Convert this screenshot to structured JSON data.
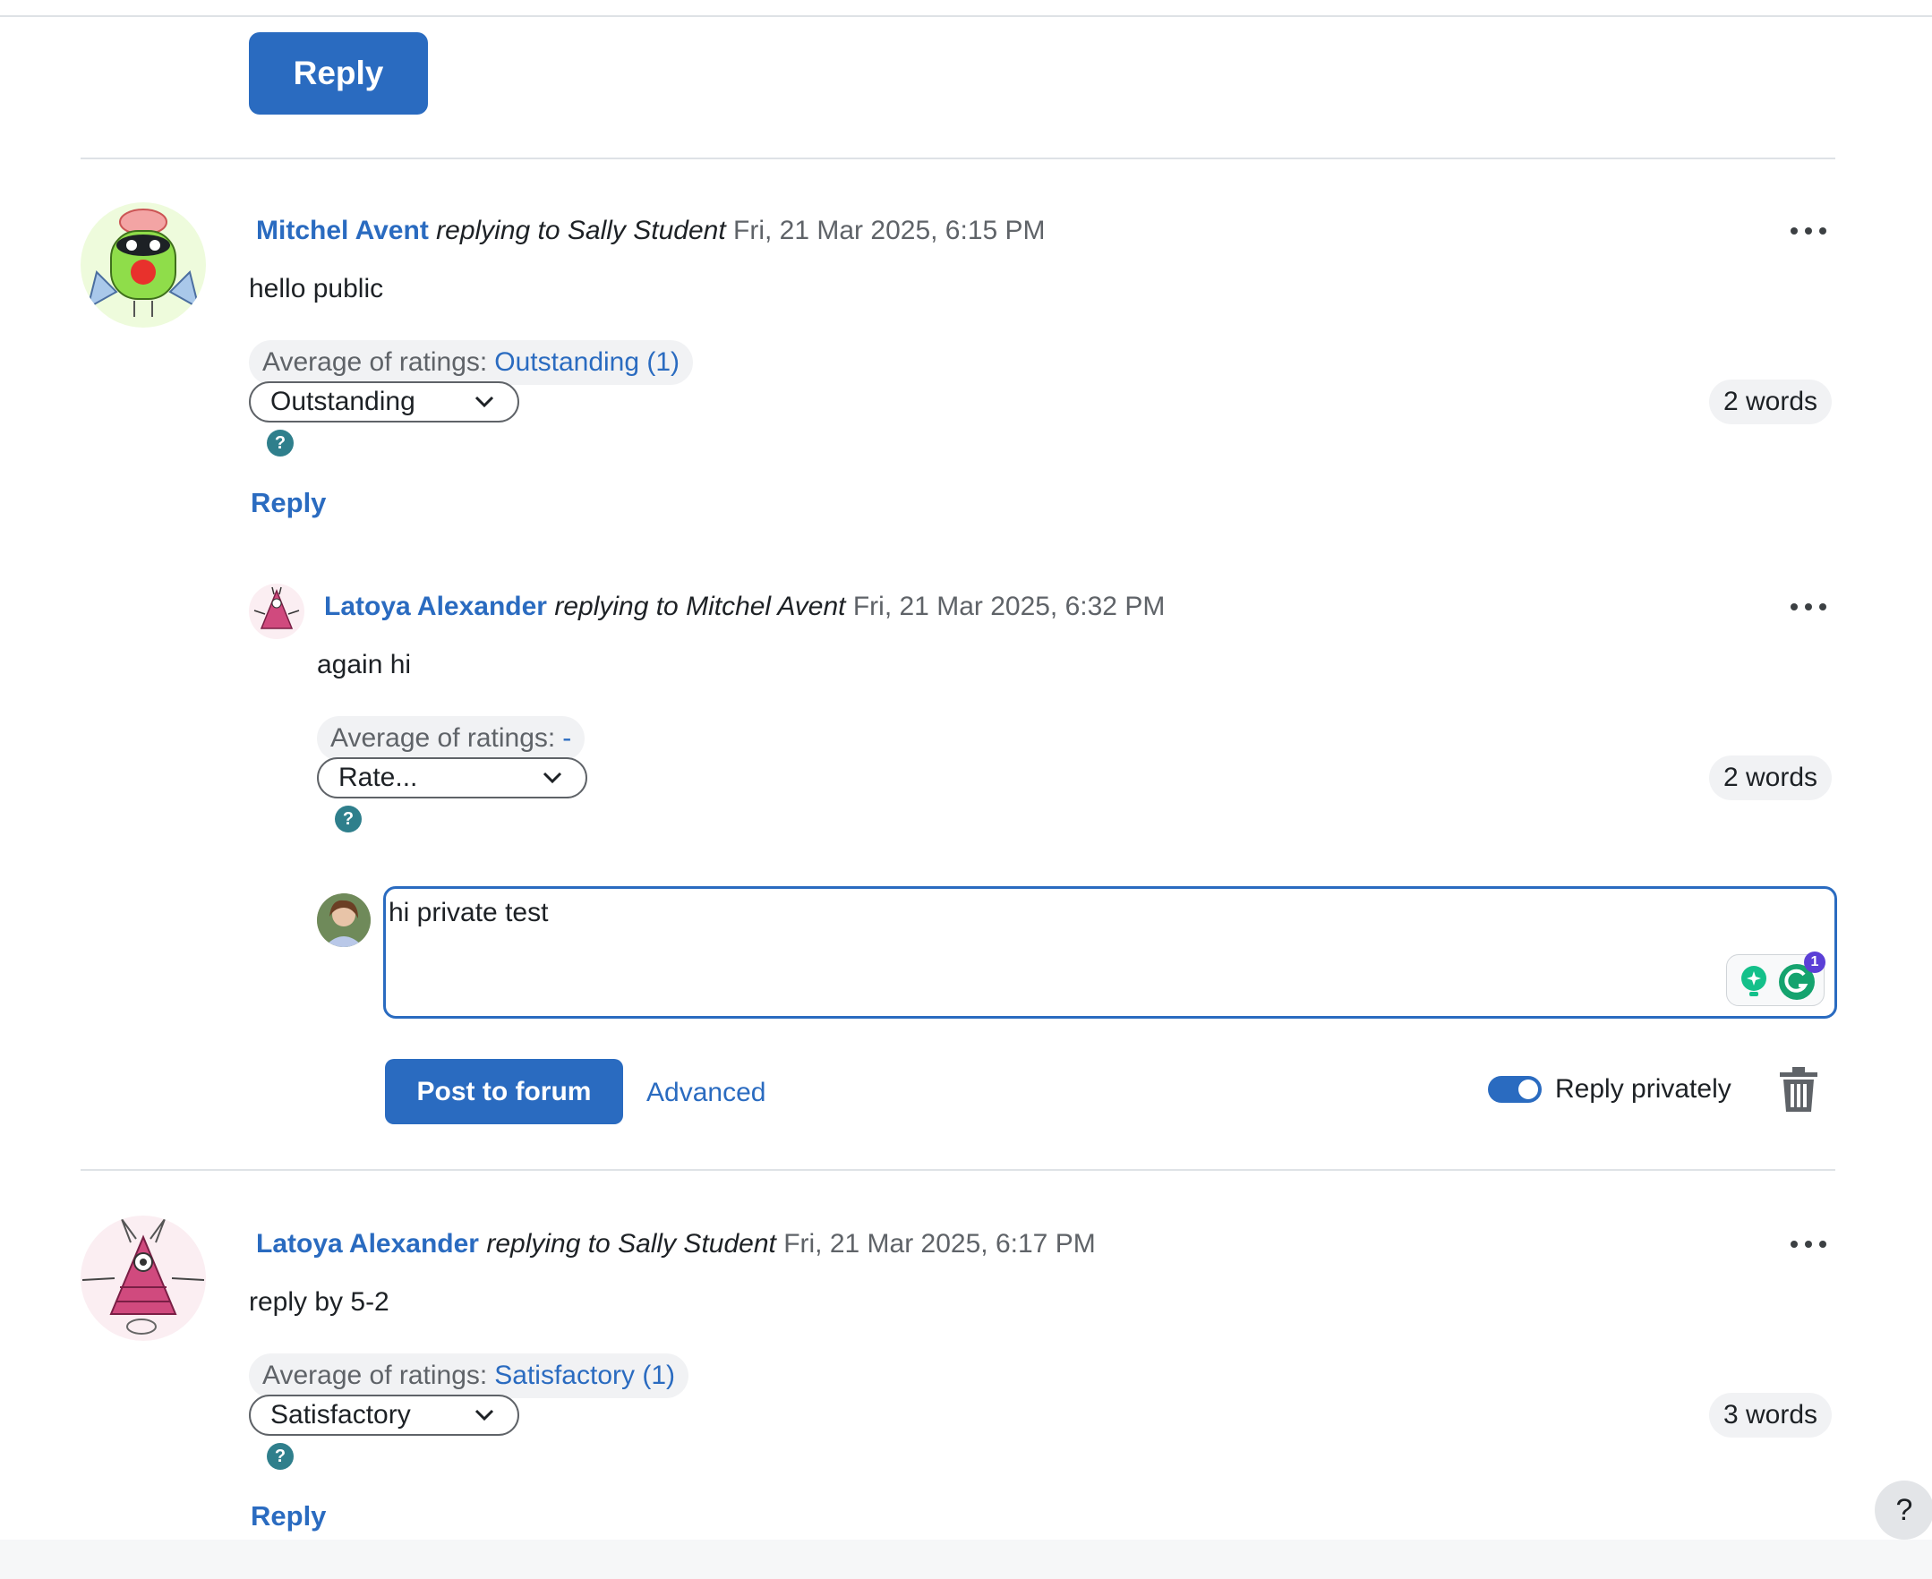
{
  "top_reply_button": "Reply",
  "posts": [
    {
      "author": "Mitchel Avent",
      "replying": "replying to Sally Student",
      "date": "Fri, 21 Mar 2025, 6:15 PM",
      "body": "hello public",
      "avg_label": "Average of ratings:",
      "avg_value": "Outstanding (1)",
      "rating_select": "Outstanding",
      "word_count": "2 words",
      "reply_label": "Reply"
    },
    {
      "author": "Latoya Alexander",
      "replying": "replying to Mitchel Avent",
      "date": "Fri, 21 Mar 2025, 6:32 PM",
      "body": "again hi",
      "avg_label": "Average of ratings:",
      "avg_value": "-",
      "rating_select": "Rate...",
      "word_count": "2 words"
    },
    {
      "author": "Latoya Alexander",
      "replying": "replying to Sally Student",
      "date": "Fri, 21 Mar 2025, 6:17 PM",
      "body": "reply by 5-2",
      "avg_label": "Average of ratings:",
      "avg_value": "Satisfactory (1)",
      "rating_select": "Satisfactory",
      "word_count": "3 words",
      "reply_label": "Reply"
    }
  ],
  "reply_form": {
    "text": "hi private test",
    "grammarly_badge": "1",
    "post_button": "Post to forum",
    "advanced_link": "Advanced",
    "private_label": "Reply privately"
  },
  "help_symbol": "?",
  "colors": {
    "accent": "#2a6bc0",
    "help": "#2f7f8c"
  }
}
